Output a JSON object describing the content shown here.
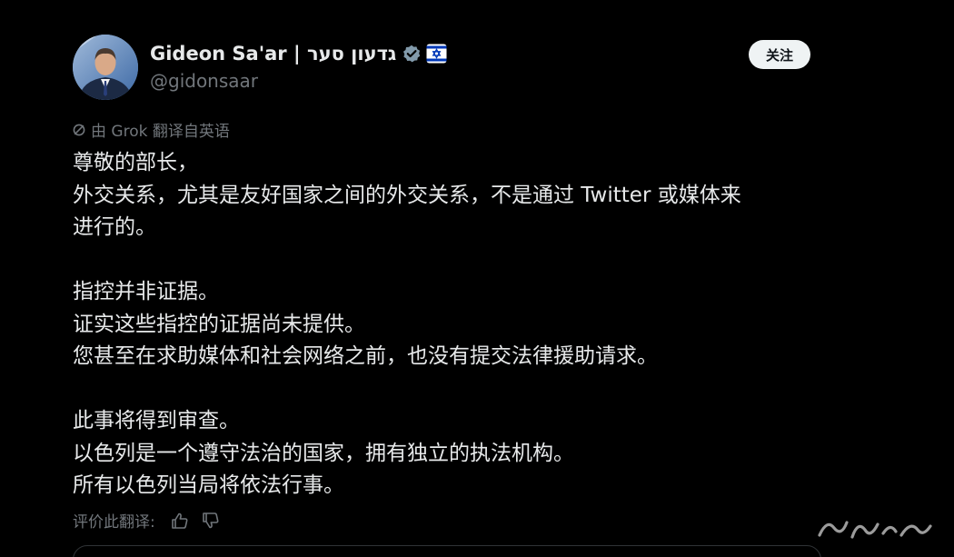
{
  "author": {
    "display_name": "Gideon Sa'ar | גדעון סער",
    "handle": "@gidonsaar",
    "verified_icon": "verified-badge-icon",
    "flag_icon": "israel-flag-icon"
  },
  "follow_button": {
    "label": "关注"
  },
  "translation": {
    "icon": "grok-icon",
    "label": "由 Grok 翻译自英语"
  },
  "body": {
    "paragraphs": [
      {
        "lines": [
          "尊敬的部长，",
          "外交关系，尤其是友好国家之间的外交关系，不是通过 Twitter 或媒体来",
          "进行的。"
        ]
      },
      {
        "lines": [
          "指控并非证据。",
          "证实这些指控的证据尚未提供。",
          "您甚至在求助媒体和社会网络之前，也没有提交法律援助请求。"
        ]
      },
      {
        "lines": [
          "此事将得到审查。",
          "以色列是一个遵守法治的国家，拥有独立的执法机构。",
          "所有以色列当局将依法行事。"
        ]
      }
    ]
  },
  "rating": {
    "label": "评价此翻译:",
    "thumb_up_icon": "thumbs-up-icon",
    "thumb_down_icon": "thumbs-down-icon"
  },
  "colors": {
    "background": "#000000",
    "text": "#e7e9ea",
    "secondary_text": "#71767b",
    "follow_button_bg": "#eff3f4",
    "verified_badge": "#829aab",
    "flag_blue": "#0038b8"
  }
}
